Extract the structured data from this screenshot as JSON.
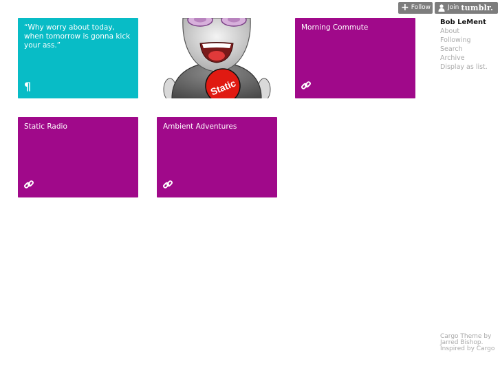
{
  "top_bar": {
    "follow_label": "Follow",
    "join_label": "Join",
    "join_brand": "tumblr."
  },
  "tiles": {
    "quote": "“Why worry about today, when tomorrow is gonna kick your ass.”",
    "morning": "Morning Commute",
    "static": "Static Radio",
    "ambient": "Ambient Adventures"
  },
  "character": {
    "shirt_text": "Static"
  },
  "sidebar": {
    "title": "Bob LeMent",
    "links": [
      "About",
      "Following",
      "Search",
      "Archive",
      "Display as list."
    ]
  },
  "footer": {
    "line1": "Cargo Theme by",
    "line2": "Jarred Bishop.",
    "line3": "Inspired by Cargo"
  },
  "colors": {
    "teal": "#08bcc6",
    "purple": "#a0098a",
    "button_gray": "#7d7d7d",
    "link_gray": "#a9a9a9"
  },
  "icons": [
    "plus-icon",
    "user-icon",
    "pilcrow-icon",
    "link-icon"
  ]
}
